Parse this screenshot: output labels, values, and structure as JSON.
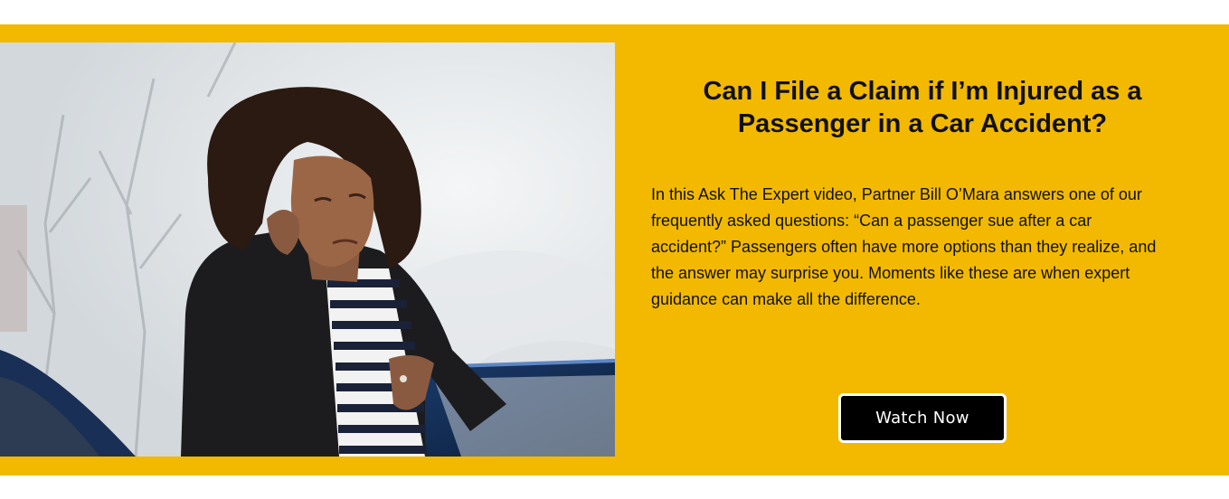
{
  "banner": {
    "background_color": "#f2b900",
    "image_description": "woman-holding-neck-at-car-door"
  },
  "headline": "Can I File a Claim if I’m Injured as a Passenger in a Car Accident?",
  "body": "In this Ask The Expert video, Partner Bill O’Mara answers one of our frequently asked questions: “Can a passenger sue after a car accident?” Passengers often have more options than they realize, and the answer may surprise you. Moments like these are when expert guidance can make all the difference.",
  "cta": {
    "label": "Watch Now",
    "background_color": "#000000",
    "text_color": "#ffffff"
  }
}
